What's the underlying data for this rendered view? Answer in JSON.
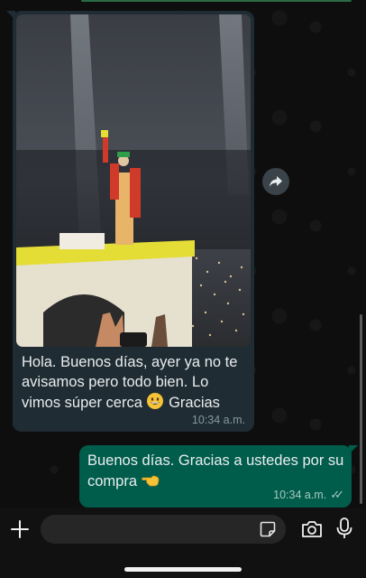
{
  "incoming": {
    "text": "Hola. Buenos días, ayer ya no te avisamos pero todo bien. Lo vimos súper cerca",
    "text_tail": "Gracias",
    "emoji": "grinning-face-emoji",
    "time": "10:34 a.m."
  },
  "outgoing": {
    "text": "Buenos días. Gracias a ustedes por su compra",
    "emoji": "backhand-index-pointing-left-emoji",
    "time": "10:34 a.m.",
    "status": "read",
    "checks_glyph": "✓✓"
  },
  "colors": {
    "incoming_bubble": "#1f2c33",
    "outgoing_bubble": "#005c4b",
    "background": "#0e0e0e"
  },
  "composer": {
    "plus_icon": "plus-icon",
    "sticker_icon": "sticker-icon",
    "camera_icon": "camera-icon",
    "mic_icon": "microphone-icon"
  }
}
